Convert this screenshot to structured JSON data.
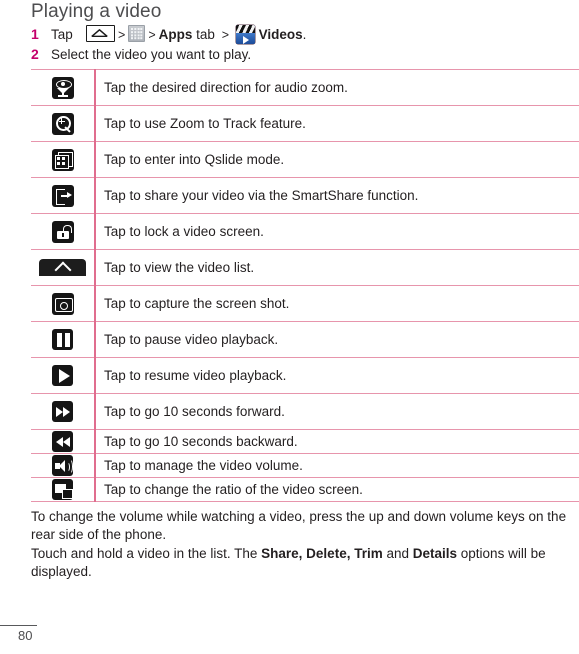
{
  "heading": "Playing a video",
  "steps": [
    {
      "num": "1",
      "lead": "Tap",
      "icon1": "home-icon",
      "sep1": ">",
      "icon2": "apps-grid-icon",
      "sep2": ">",
      "apps_label": "Apps",
      "tab_word": "tab",
      "sep3": ">",
      "icon3": "videos-app-icon",
      "videos_label": "Videos",
      "period": "."
    },
    {
      "num": "2",
      "text": "Select the video you want to play."
    }
  ],
  "table": {
    "rows": [
      {
        "icon": "audio-zoom-icon",
        "desc": "Tap the desired direction for audio zoom."
      },
      {
        "icon": "zoom-to-track-icon",
        "desc": "Tap to use Zoom to Track feature."
      },
      {
        "icon": "qslide-icon",
        "desc": "Tap to enter into Qslide mode."
      },
      {
        "icon": "smartshare-icon",
        "desc": "Tap to share your video via the SmartShare function."
      },
      {
        "icon": "lock-screen-icon",
        "desc": "Tap to lock a video screen."
      },
      {
        "icon": "video-list-chevron-up-icon",
        "desc": "Tap to view the video list."
      },
      {
        "icon": "screen-capture-icon",
        "desc": "Tap to capture the screen shot."
      },
      {
        "icon": "pause-icon",
        "desc": "Tap to pause video playback."
      },
      {
        "icon": "play-icon",
        "desc": "Tap to resume video playback."
      },
      {
        "icon": "fast-forward-icon",
        "desc": "Tap to go 10 seconds forward."
      },
      {
        "icon": "rewind-icon",
        "desc": "Tap to go 10 seconds backward."
      },
      {
        "icon": "volume-icon",
        "desc": "Tap to manage the video volume."
      },
      {
        "icon": "aspect-ratio-icon",
        "desc": "Tap to change the ratio of the video screen."
      }
    ]
  },
  "paragraphs": {
    "volume_note": "To change the volume while watching a video, press the up and down volume keys on the rear side of the phone.",
    "longpress_prefix": "Touch and hold a video in the list. The ",
    "longpress_bold1": "Share, Delete, Trim",
    "longpress_mid": " and ",
    "longpress_bold2": "Details",
    "longpress_suffix": " options will be displayed."
  },
  "footer": {
    "page_number": "80"
  },
  "colors": {
    "rule_pink": "#e795ac",
    "divider_pink": "#e06d8e",
    "step_number": "#c4006b",
    "heading": "#4d4d4f",
    "body_text": "#231f20"
  }
}
